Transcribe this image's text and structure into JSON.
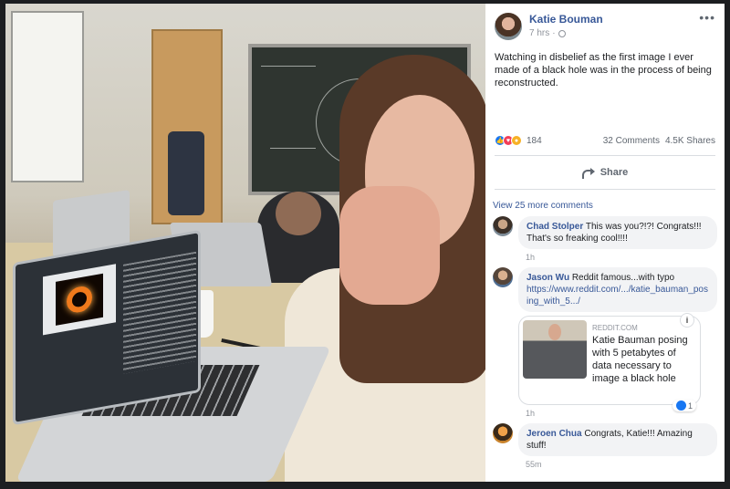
{
  "post": {
    "author": "Katie Bouman",
    "time": "7 hrs",
    "separator": "·",
    "more": "•••",
    "text": "Watching in disbelief as the first image I ever made of a black hole was in the process of being reconstructed."
  },
  "stats": {
    "reaction_count": "184",
    "comments": "32 Comments",
    "shares": "4.5K Shares",
    "reactions": [
      "like",
      "love",
      "wow"
    ]
  },
  "actions": {
    "share": "Share"
  },
  "comments_section": {
    "view_more": "View 25 more comments",
    "comments": [
      {
        "name": "Chad Stolper",
        "text": "This was you?!?! Congrats!!! That's so freaking cool!!!!",
        "time": "1h"
      },
      {
        "name": "Jason Wu",
        "text": "Reddit famous...with typo",
        "link": "https://www.reddit.com/.../katie_bauman_posing_with_5.../",
        "time": "1h",
        "card": {
          "domain": "REDDIT.COM",
          "title": "Katie Bauman posing with 5 petabytes of data necessary to image a black hole",
          "likes": "1",
          "info": "i"
        }
      },
      {
        "name": "Jeroen Chua",
        "text": "Congrats, Katie!!! Amazing stuff!",
        "time": "55m"
      }
    ]
  },
  "colors": {
    "link": "#385898",
    "bubble": "#f2f3f5",
    "like": "#1877f2",
    "love": "#f33e58",
    "wow": "#f7b125"
  }
}
